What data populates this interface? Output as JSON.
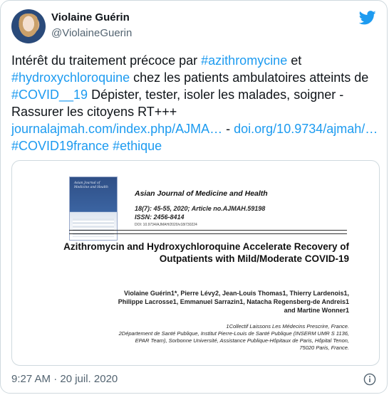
{
  "author": {
    "name": "Violaine Guérin",
    "handle": "@ViolaineGuerin"
  },
  "icons": {
    "brand": "twitter-bird-icon",
    "info": "info-icon",
    "brand_color": "#1d9bf0"
  },
  "tweet": {
    "t1": "Intérêt du traitement précoce par ",
    "h1": "#azithromycine",
    "t2": " et ",
    "h2": "#hydroxychloroquine",
    "t3": " chez les patients ambulatoires atteints de ",
    "h3": "#COVID__19",
    "t4": " Dépister, tester, isoler les malades, soigner - Rassurer les citoyens RT+++ ",
    "l1": "journalajmah.com/index.php/AJMA…",
    "t5": " - ",
    "l2": "doi.org/10.9734/ajmah/…",
    "t6": "  ",
    "h4": "#COVID19france",
    "t7": " ",
    "h5": "#ethique"
  },
  "card": {
    "journal": "Asian Journal of Medicine and Health",
    "meta1": "18(7): 45-55, 2020; Article no.AJMAH.59198",
    "meta2": "ISSN: 2456-8414",
    "doi": "DOI: 10.9734/AJMAH/2020/v18i730224",
    "cover_title": "Asian Journal of Medicine and Health",
    "title": "Azithromycin and Hydroxychloroquine Accelerate Recovery of Outpatients with Mild/Moderate COVID-19",
    "authors_line1": "Violaine Guérin1*, Pierre Lévy2, Jean-Louis Thomas1, Thierry Lardenois1,",
    "authors_line2": "Philippe Lacrosse1, Emmanuel Sarrazin1, Natacha Regensberg-de Andreis1",
    "authors_line3": "and Martine Wonner1",
    "affil1": "1Collectif Laissons Les Médecins Prescrire, France.",
    "affil2": "2Département de Santé Publique, Institut Pierre-Louis de Santé Publique (INSERM UMR S 1136,",
    "affil3": "EPAR Team), Sorbonne Université, Assistance Publique-Hôpitaux de Paris, Hôpital Tenon,",
    "affil4": "75020 Paris, France."
  },
  "footer": {
    "timestamp": "9:27 AM · 20 juil. 2020"
  }
}
